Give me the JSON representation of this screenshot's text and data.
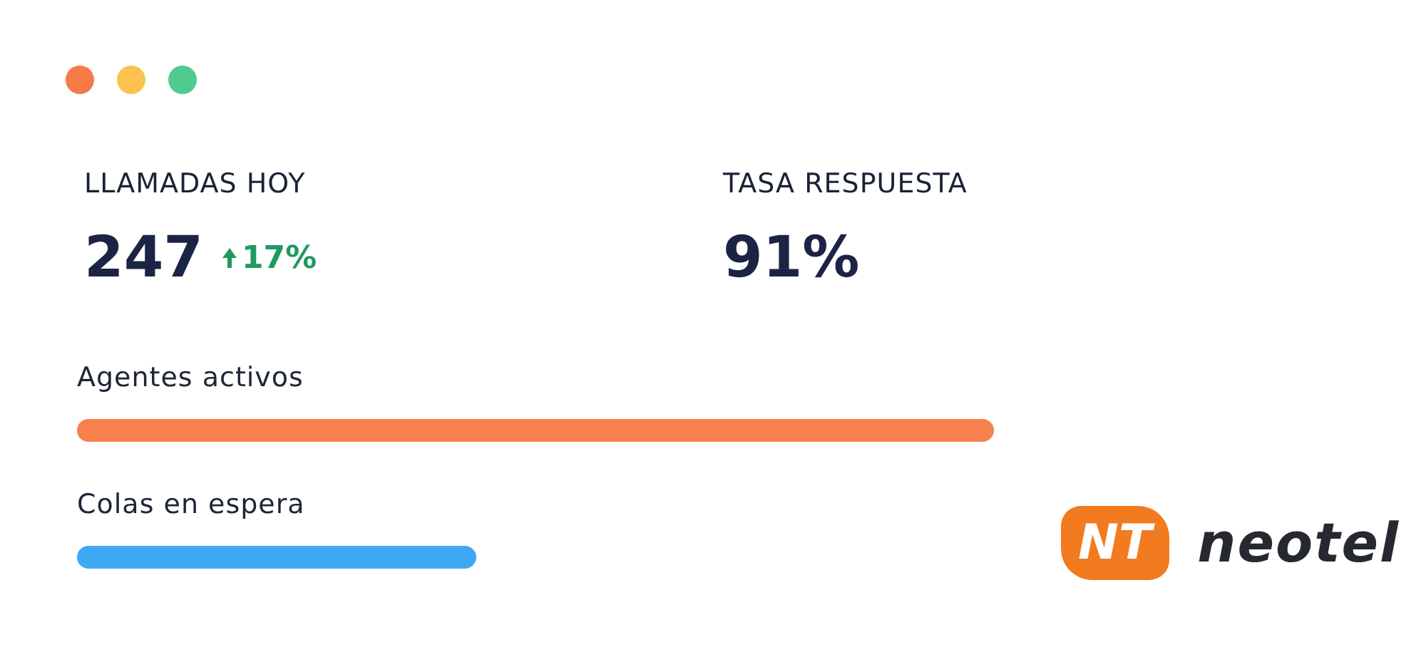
{
  "window": {
    "controls": [
      {
        "color": "#f67a45"
      },
      {
        "color": "#fbc24d"
      },
      {
        "color": "#4fcb8f"
      }
    ]
  },
  "stats": [
    {
      "label": "LLAMADAS HOY",
      "value": "247",
      "change": "17%"
    },
    {
      "label": "TASA RESPUESTA",
      "value": "91%"
    }
  ],
  "bars": [
    {
      "label": "Agentes activos",
      "color": "#f7804c"
    },
    {
      "label": "Colas en espera",
      "color": "#3fa8f4"
    }
  ],
  "logo": {
    "mark": "NT",
    "wordmark": "neotel"
  }
}
